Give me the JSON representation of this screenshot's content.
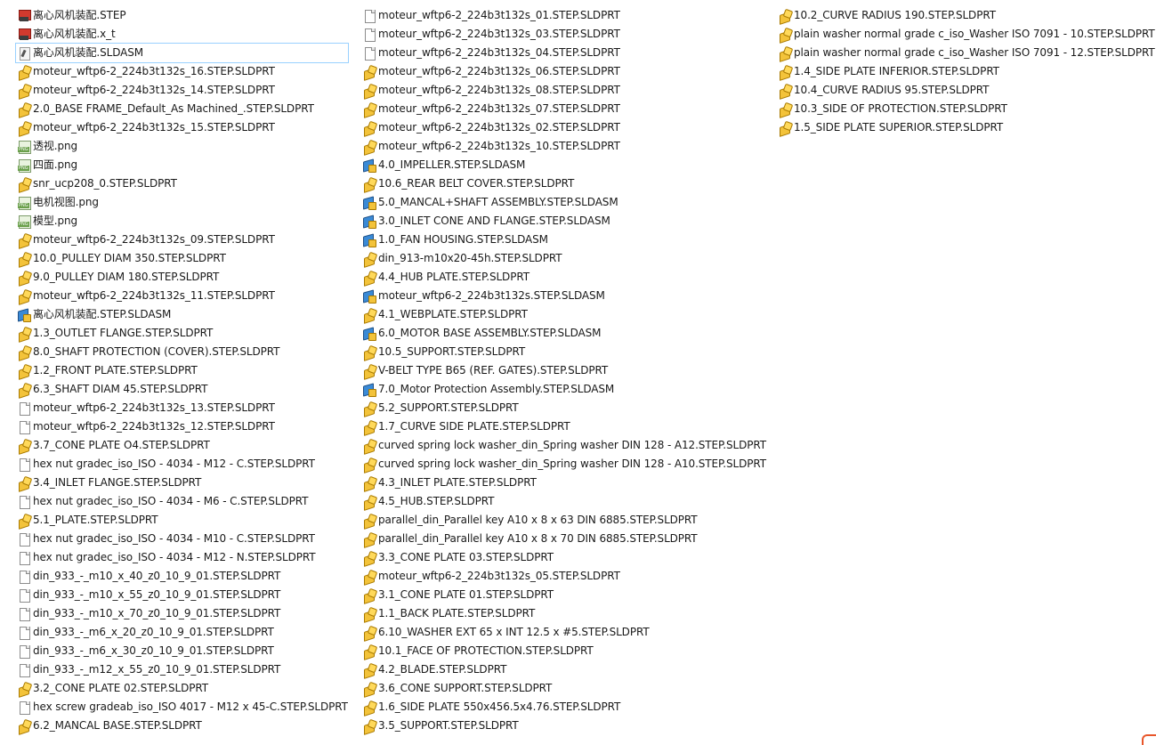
{
  "columns": [
    {
      "items": [
        {
          "type": "step",
          "name": "离心风机装配.STEP"
        },
        {
          "type": "step",
          "name": "离心风机装配.x_t"
        },
        {
          "type": "drw",
          "name": "离心风机装配.SLDASM",
          "selected": true
        },
        {
          "type": "part",
          "name": "moteur_wftp6-2_224b3t132s_16.STEP.SLDPRT"
        },
        {
          "type": "part",
          "name": "moteur_wftp6-2_224b3t132s_14.STEP.SLDPRT"
        },
        {
          "type": "part",
          "name": "2.0_BASE FRAME_Default_As Machined_.STEP.SLDPRT"
        },
        {
          "type": "part",
          "name": "moteur_wftp6-2_224b3t132s_15.STEP.SLDPRT"
        },
        {
          "type": "png",
          "name": "透视.png"
        },
        {
          "type": "png",
          "name": "四面.png"
        },
        {
          "type": "part",
          "name": "snr_ucp208_0.STEP.SLDPRT"
        },
        {
          "type": "png",
          "name": "电机视图.png"
        },
        {
          "type": "png",
          "name": "模型.png"
        },
        {
          "type": "part",
          "name": "moteur_wftp6-2_224b3t132s_09.STEP.SLDPRT"
        },
        {
          "type": "part",
          "name": "10.0_PULLEY DIAM 350.STEP.SLDPRT"
        },
        {
          "type": "part",
          "name": "9.0_PULLEY DIAM 180.STEP.SLDPRT"
        },
        {
          "type": "part",
          "name": "moteur_wftp6-2_224b3t132s_11.STEP.SLDPRT"
        },
        {
          "type": "asm",
          "name": "离心风机装配.STEP.SLDASM"
        },
        {
          "type": "part",
          "name": "1.3_OUTLET FLANGE.STEP.SLDPRT"
        },
        {
          "type": "part",
          "name": "8.0_SHAFT PROTECTION (COVER).STEP.SLDPRT"
        },
        {
          "type": "part",
          "name": "1.2_FRONT PLATE.STEP.SLDPRT"
        },
        {
          "type": "part",
          "name": "6.3_SHAFT DIAM 45.STEP.SLDPRT"
        },
        {
          "type": "file",
          "name": "moteur_wftp6-2_224b3t132s_13.STEP.SLDPRT"
        },
        {
          "type": "file",
          "name": "moteur_wftp6-2_224b3t132s_12.STEP.SLDPRT"
        },
        {
          "type": "part",
          "name": "3.7_CONE PLATE O4.STEP.SLDPRT"
        },
        {
          "type": "file",
          "name": "hex nut gradec_iso_ISO - 4034 - M12 - C.STEP.SLDPRT"
        },
        {
          "type": "part",
          "name": "3.4_INLET FLANGE.STEP.SLDPRT"
        },
        {
          "type": "file",
          "name": "hex nut gradec_iso_ISO - 4034 - M6 - C.STEP.SLDPRT"
        },
        {
          "type": "part",
          "name": "5.1_PLATE.STEP.SLDPRT"
        },
        {
          "type": "file",
          "name": "hex nut gradec_iso_ISO - 4034 - M10 - C.STEP.SLDPRT"
        },
        {
          "type": "file",
          "name": "hex nut gradec_iso_ISO - 4034 - M12 - N.STEP.SLDPRT"
        },
        {
          "type": "file",
          "name": "din_933_-_m10_x_40_z0_10_9_01.STEP.SLDPRT"
        },
        {
          "type": "file",
          "name": "din_933_-_m10_x_55_z0_10_9_01.STEP.SLDPRT"
        },
        {
          "type": "file",
          "name": "din_933_-_m10_x_70_z0_10_9_01.STEP.SLDPRT"
        },
        {
          "type": "file",
          "name": "din_933_-_m6_x_20_z0_10_9_01.STEP.SLDPRT"
        },
        {
          "type": "file",
          "name": "din_933_-_m6_x_30_z0_10_9_01.STEP.SLDPRT"
        },
        {
          "type": "file",
          "name": "din_933_-_m12_x_55_z0_10_9_01.STEP.SLDPRT"
        },
        {
          "type": "part",
          "name": "3.2_CONE PLATE 02.STEP.SLDPRT"
        },
        {
          "type": "file",
          "name": "hex screw gradeab_iso_ISO 4017 - M12 x 45-C.STEP.SLDPRT"
        },
        {
          "type": "part",
          "name": "6.2_MANCAL BASE.STEP.SLDPRT"
        }
      ]
    },
    {
      "items": [
        {
          "type": "file",
          "name": "moteur_wftp6-2_224b3t132s_01.STEP.SLDPRT"
        },
        {
          "type": "file",
          "name": "moteur_wftp6-2_224b3t132s_03.STEP.SLDPRT"
        },
        {
          "type": "file",
          "name": "moteur_wftp6-2_224b3t132s_04.STEP.SLDPRT"
        },
        {
          "type": "part",
          "name": "moteur_wftp6-2_224b3t132s_06.STEP.SLDPRT"
        },
        {
          "type": "part",
          "name": "moteur_wftp6-2_224b3t132s_08.STEP.SLDPRT"
        },
        {
          "type": "part",
          "name": "moteur_wftp6-2_224b3t132s_07.STEP.SLDPRT"
        },
        {
          "type": "part",
          "name": "moteur_wftp6-2_224b3t132s_02.STEP.SLDPRT"
        },
        {
          "type": "part",
          "name": "moteur_wftp6-2_224b3t132s_10.STEP.SLDPRT"
        },
        {
          "type": "asm",
          "name": "4.0_IMPELLER.STEP.SLDASM"
        },
        {
          "type": "part",
          "name": "10.6_REAR BELT COVER.STEP.SLDPRT"
        },
        {
          "type": "asm",
          "name": "5.0_MANCAL+SHAFT ASSEMBLY.STEP.SLDASM"
        },
        {
          "type": "asm",
          "name": "3.0_INLET CONE AND FLANGE.STEP.SLDASM"
        },
        {
          "type": "asm",
          "name": "1.0_FAN HOUSING.STEP.SLDASM"
        },
        {
          "type": "part",
          "name": "din_913-m10x20-45h.STEP.SLDPRT"
        },
        {
          "type": "part",
          "name": "4.4_HUB PLATE.STEP.SLDPRT"
        },
        {
          "type": "asm",
          "name": "moteur_wftp6-2_224b3t132s.STEP.SLDASM"
        },
        {
          "type": "part",
          "name": "4.1_WEBPLATE.STEP.SLDPRT"
        },
        {
          "type": "asm",
          "name": "6.0_MOTOR BASE ASSEMBLY.STEP.SLDASM"
        },
        {
          "type": "part",
          "name": "10.5_SUPPORT.STEP.SLDPRT"
        },
        {
          "type": "part",
          "name": "V-BELT TYPE B65 (REF. GATES).STEP.SLDPRT"
        },
        {
          "type": "asm",
          "name": "7.0_Motor Protection Assembly.STEP.SLDASM"
        },
        {
          "type": "part",
          "name": "5.2_SUPPORT.STEP.SLDPRT"
        },
        {
          "type": "part",
          "name": "1.7_CURVE SIDE PLATE.STEP.SLDPRT"
        },
        {
          "type": "part",
          "name": "curved spring lock washer_din_Spring washer DIN 128 - A12.STEP.SLDPRT"
        },
        {
          "type": "part",
          "name": "curved spring lock washer_din_Spring washer DIN 128 - A10.STEP.SLDPRT"
        },
        {
          "type": "part",
          "name": "4.3_INLET PLATE.STEP.SLDPRT"
        },
        {
          "type": "part",
          "name": "4.5_HUB.STEP.SLDPRT"
        },
        {
          "type": "part",
          "name": "parallel_din_Parallel key A10 x 8 x 63 DIN 6885.STEP.SLDPRT"
        },
        {
          "type": "part",
          "name": "parallel_din_Parallel key A10 x 8 x 70 DIN 6885.STEP.SLDPRT"
        },
        {
          "type": "part",
          "name": "3.3_CONE PLATE 03.STEP.SLDPRT"
        },
        {
          "type": "part",
          "name": "moteur_wftp6-2_224b3t132s_05.STEP.SLDPRT"
        },
        {
          "type": "part",
          "name": "3.1_CONE PLATE 01.STEP.SLDPRT"
        },
        {
          "type": "part",
          "name": "1.1_BACK PLATE.STEP.SLDPRT"
        },
        {
          "type": "part",
          "name": "6.10_WASHER EXT 65 x INT 12.5 x #5.STEP.SLDPRT"
        },
        {
          "type": "part",
          "name": "10.1_FACE OF PROTECTION.STEP.SLDPRT"
        },
        {
          "type": "part",
          "name": "4.2_BLADE.STEP.SLDPRT"
        },
        {
          "type": "part",
          "name": "3.6_CONE SUPPORT.STEP.SLDPRT"
        },
        {
          "type": "part",
          "name": "1.6_SIDE PLATE 550x456.5x4.76.STEP.SLDPRT"
        },
        {
          "type": "part",
          "name": "3.5_SUPPORT.STEP.SLDPRT"
        }
      ]
    },
    {
      "items": [
        {
          "type": "part",
          "name": "10.2_CURVE RADIUS 190.STEP.SLDPRT"
        },
        {
          "type": "part",
          "name": "plain washer normal grade c_iso_Washer ISO 7091 - 10.STEP.SLDPRT"
        },
        {
          "type": "part",
          "name": "plain washer normal grade c_iso_Washer ISO 7091 - 12.STEP.SLDPRT"
        },
        {
          "type": "part",
          "name": "1.4_SIDE PLATE INFERIOR.STEP.SLDPRT"
        },
        {
          "type": "part",
          "name": "10.4_CURVE RADIUS 95.STEP.SLDPRT"
        },
        {
          "type": "part",
          "name": "10.3_SIDE OF PROTECTION.STEP.SLDPRT"
        },
        {
          "type": "part",
          "name": "1.5_SIDE PLATE SUPERIOR.STEP.SLDPRT"
        }
      ]
    }
  ],
  "icon_names": {
    "part": "solidworks-part-icon",
    "asm": "solidworks-assembly-icon",
    "file": "blank-file-icon",
    "png": "png-image-icon",
    "step": "step-file-icon",
    "drw": "solidworks-file-icon"
  }
}
